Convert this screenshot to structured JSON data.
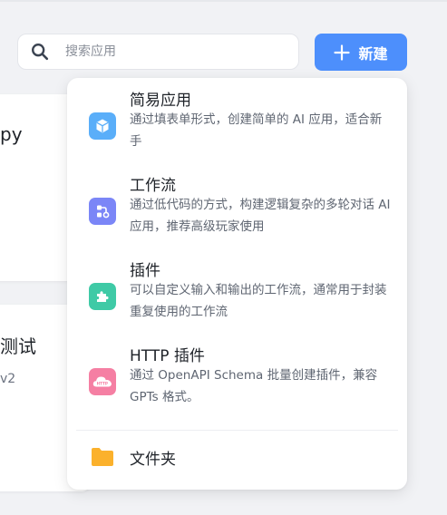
{
  "background_cards": [
    {
      "title_fragment": "py",
      "subtitle_fragment": ""
    },
    {
      "title_fragment": "测试",
      "subtitle_fragment": "v2"
    }
  ],
  "search": {
    "placeholder": "搜索应用"
  },
  "new_button": {
    "label": "新建"
  },
  "menu": {
    "items": [
      {
        "title": "简易应用",
        "description": "通过填表单形式，创建简单的 AI 应用，适合新手",
        "icon": "cube-icon",
        "color": "#5aaef9"
      },
      {
        "title": "工作流",
        "description": "通过低代码的方式，构建逻辑复杂的多轮对话 AI 应用，推荐高级玩家使用",
        "icon": "workflow-icon",
        "color": "#7b86f7"
      },
      {
        "title": "插件",
        "description": "可以自定义输入和输出的工作流，通常用于封装重复使用的工作流",
        "icon": "puzzle-icon",
        "color": "#3fcaa6"
      },
      {
        "title": "HTTP 插件",
        "description": "通过 OpenAPI Schema 批量创建插件，兼容 GPTs 格式。",
        "icon": "cloud-http-icon",
        "color": "#f57fa3",
        "icon_text": "HTTP"
      }
    ],
    "folder": {
      "label": "文件夹",
      "icon": "folder-icon",
      "color": "#fbb12c"
    }
  }
}
